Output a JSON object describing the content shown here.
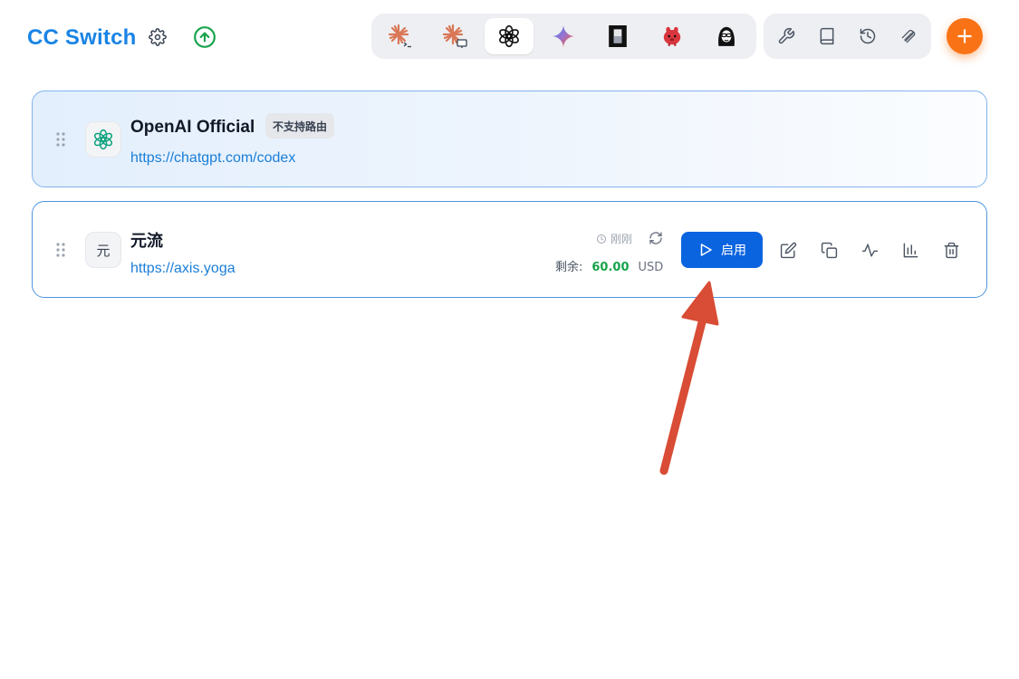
{
  "header": {
    "title": "CC Switch",
    "settings_icon": "gear-icon",
    "update_icon": "arrow-up-circle-icon"
  },
  "app_switcher": [
    {
      "name": "claude-code",
      "icon": "claude-terminal-icon",
      "active": false
    },
    {
      "name": "claude-desktop",
      "icon": "claude-desktop-icon",
      "active": false
    },
    {
      "name": "codex",
      "icon": "openai-icon",
      "active": true
    },
    {
      "name": "gemini",
      "icon": "gemini-icon",
      "active": false
    },
    {
      "name": "opencode",
      "icon": "opencode-icon",
      "active": false
    },
    {
      "name": "red-app",
      "icon": "red-mascot-icon",
      "active": false
    },
    {
      "name": "avatar-app",
      "icon": "character-icon",
      "active": false
    }
  ],
  "tools": [
    {
      "name": "tools",
      "icon": "wrench-icon"
    },
    {
      "name": "docs",
      "icon": "book-icon"
    },
    {
      "name": "history",
      "icon": "history-icon"
    },
    {
      "name": "skills",
      "icon": "paperclip-stack-icon"
    }
  ],
  "providers": [
    {
      "name": "OpenAI Official",
      "url": "https://chatgpt.com/codex",
      "badge": "不支持路由",
      "active": true
    },
    {
      "name": "元流",
      "icon_text": "元",
      "url": "https://axis.yoga",
      "usage_time": "刚刚",
      "remaining_label": "剩余:",
      "remaining_amount": "60.00",
      "remaining_currency": "USD",
      "enable_label": "启用"
    }
  ],
  "colors": {
    "brand": "#1a84e5",
    "enable_button": "#0a64e0",
    "add_button": "#f97316",
    "annotation_arrow": "#d94c35"
  }
}
